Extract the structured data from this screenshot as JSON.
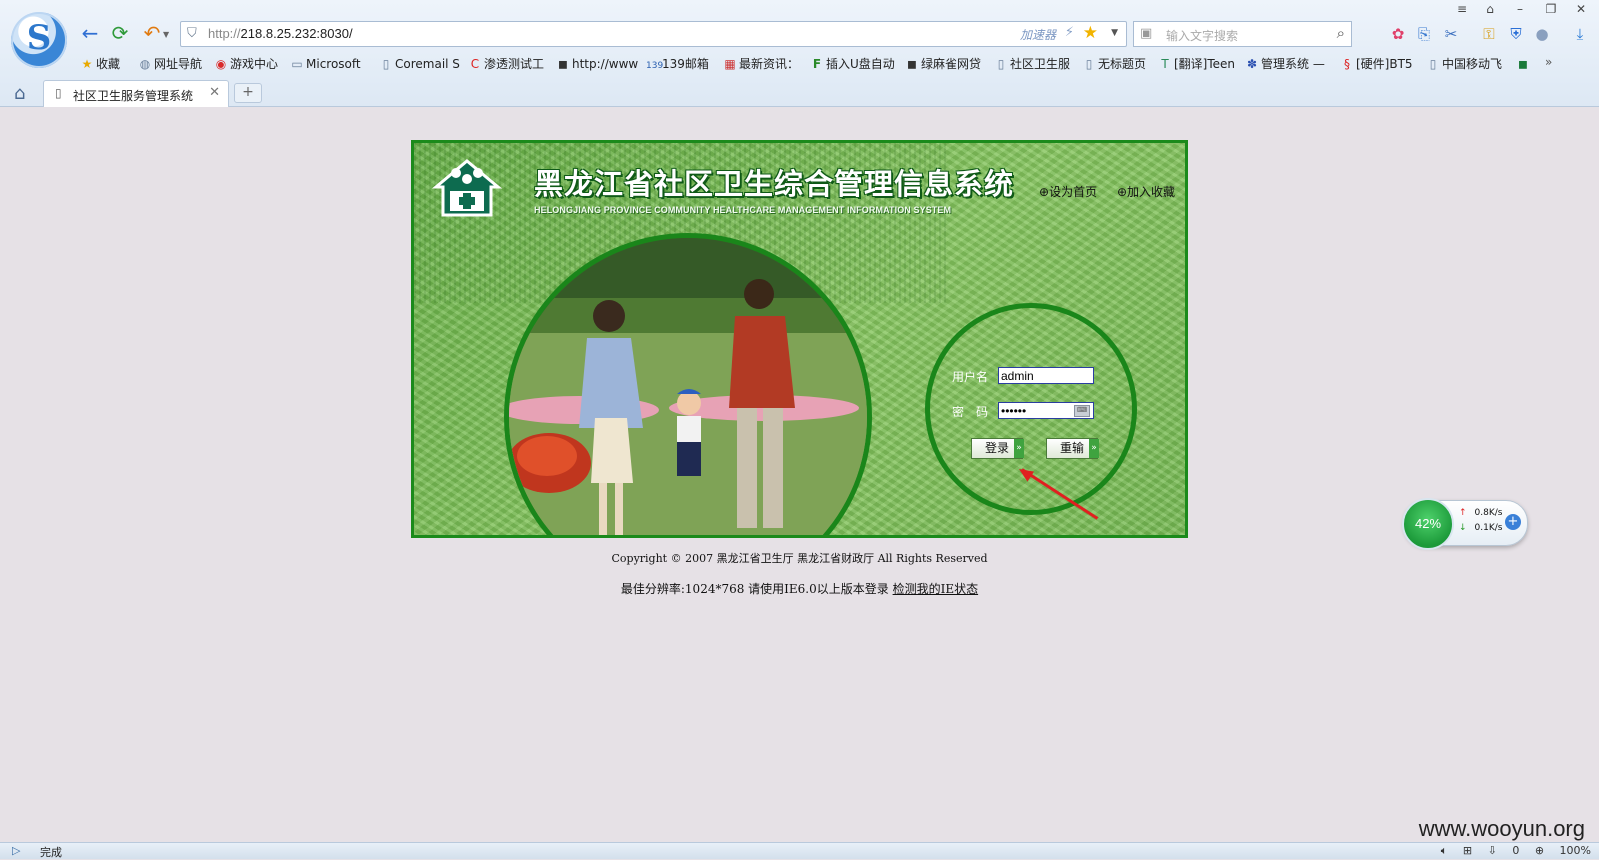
{
  "browser": {
    "url_host": "http://",
    "url_path": "218.8.25.232:8030/",
    "accelerator_label": "加速器",
    "search_placeholder": "输入文字搜索",
    "bookmarks": [
      {
        "icon": "star-icon",
        "label": "收藏"
      },
      {
        "icon": "globe-icon",
        "label": "网址导航"
      },
      {
        "icon": "game-icon",
        "label": "游戏中心"
      },
      {
        "icon": "folder-icon",
        "label": "Microsoft"
      },
      {
        "icon": "page-icon",
        "label": "Coremail S"
      },
      {
        "icon": "c-logo-icon",
        "label": "渗透测试工"
      },
      {
        "icon": "site-icon",
        "label": "http://www"
      },
      {
        "icon": "mail-139-icon",
        "label": "139邮箱"
      },
      {
        "icon": "news-icon",
        "label": "最新资讯："
      },
      {
        "icon": "f-logo-icon",
        "label": "插入U盘自动"
      },
      {
        "icon": "site-icon",
        "label": "绿麻雀网贷"
      },
      {
        "icon": "page-icon",
        "label": "社区卫生服"
      },
      {
        "icon": "page-icon",
        "label": "无标题页"
      },
      {
        "icon": "translate-icon",
        "label": "[翻译]Teen"
      },
      {
        "icon": "paw-icon",
        "label": "管理系统 —"
      },
      {
        "icon": "bt-icon",
        "label": "[硬件]BT5"
      },
      {
        "icon": "page-icon",
        "label": "中国移动飞"
      }
    ],
    "tab_title": "社区卫生服务管理系统",
    "status_text": "完成",
    "zoom": "100%",
    "download_count": "0"
  },
  "page": {
    "system_title": "黑龙江省社区卫生综合管理信息系统",
    "system_subtitle": "HELONGJIANG PROVINCE COMMUNITY HEALTHCARE MANAGEMENT INFORMATION SYSTEM",
    "set_home": "⊕设为首页",
    "add_favorite": "⊕加入收藏",
    "username_label": "用户名",
    "password_label": "密　码",
    "username_value": "admin",
    "password_value": "••••••",
    "login_button": "登录",
    "reset_button": "重输",
    "copyright": "Copyright © 2007 黑龙江省卫生厅 黑龙江省财政厅 All Rights Reserved",
    "resolution_note": "最佳分辨率:1024*768 请使用IE6.0以上版本登录",
    "check_ie_link": "检测我的IE状态"
  },
  "widget": {
    "percent": "42%",
    "upload": "0.8K/s",
    "download": "0.1K/s"
  },
  "watermark": "www.wooyun.org",
  "colors": {
    "panel_border": "#1b8a1b",
    "panel_bg": "#79bb55",
    "arrow": "#e02020"
  }
}
